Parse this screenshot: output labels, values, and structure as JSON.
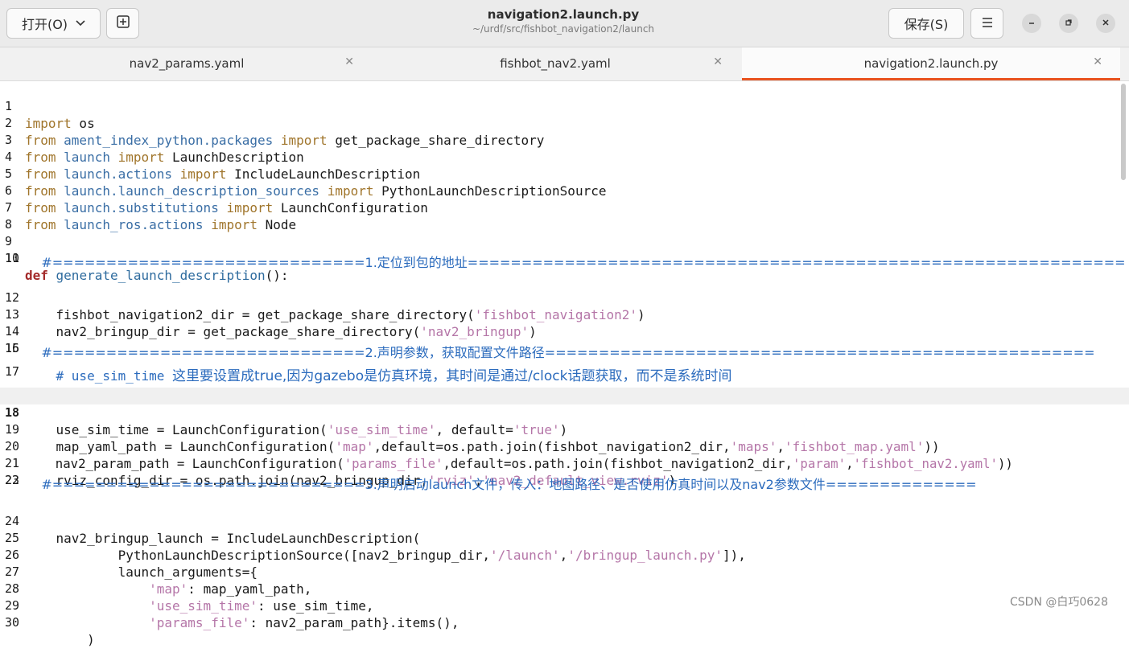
{
  "window": {
    "open_label": "打开(O)",
    "save_label": "保存(S)",
    "title": "navigation2.launch.py",
    "subtitle": "~/urdf/src/fishbot_navigation2/launch"
  },
  "icons": {
    "chevron": "chevron-down-icon",
    "pin": "pin-icon",
    "menu": "hamburger-icon",
    "minimize": "minimize-icon",
    "maximize": "restore-icon",
    "close": "close-icon"
  },
  "colors": {
    "accent": "#e95420",
    "keyword": "#a0752b",
    "string": "#b576a8",
    "comment": "#2b6bbd"
  },
  "tabs": [
    {
      "label": "nav2_params.yaml"
    },
    {
      "label": "fishbot_nav2.yaml"
    },
    {
      "label": "navigation2.launch.py"
    }
  ],
  "editor": {
    "current_line": 18,
    "lines": [
      {
        "n": "1"
      },
      {
        "n": "2"
      },
      {
        "n": "3"
      },
      {
        "n": "4"
      },
      {
        "n": "5"
      },
      {
        "n": "6"
      },
      {
        "n": "7"
      },
      {
        "n": "8"
      },
      {
        "n": "9"
      },
      {
        "n": "10"
      },
      {
        "n": "11"
      },
      {
        "n": "12"
      },
      {
        "n": "13"
      },
      {
        "n": "14"
      },
      {
        "n": "15"
      },
      {
        "n": "16"
      },
      {
        "n": "17"
      },
      {
        "n": "18"
      },
      {
        "n": "19"
      },
      {
        "n": "20"
      },
      {
        "n": "21"
      },
      {
        "n": "22"
      },
      {
        "n": "23"
      },
      {
        "n": "24"
      },
      {
        "n": "25"
      },
      {
        "n": "26"
      },
      {
        "n": "27"
      },
      {
        "n": "28"
      },
      {
        "n": "29"
      },
      {
        "n": "30"
      }
    ],
    "code": {
      "l1": {
        "kw": "import",
        "rest": " os"
      },
      "l2": {
        "kw1": "from",
        "mod": " ament_index_python.packages ",
        "kw2": "import",
        "rest": " get_package_share_directory"
      },
      "l3": {
        "kw1": "from",
        "mod": " launch ",
        "kw2": "import",
        "rest": " LaunchDescription"
      },
      "l4": {
        "kw1": "from",
        "mod": " launch.actions ",
        "kw2": "import",
        "rest": " IncludeLaunchDescription"
      },
      "l5": {
        "kw1": "from",
        "mod": " launch.launch_description_sources ",
        "kw2": "import",
        "rest": " PythonLaunchDescriptionSource"
      },
      "l6": {
        "kw1": "from",
        "mod": " launch.substitutions ",
        "kw2": "import",
        "rest": " LaunchConfiguration"
      },
      "l7": {
        "kw1": "from",
        "mod": " launch_ros.actions ",
        "kw2": "import",
        "rest": " Node"
      },
      "l10": {
        "def": "def",
        "fn": " generate_launch_description",
        "rest": "():"
      },
      "l11": {
        "comment": "    #=============================1.定位到包的地址============================================================="
      },
      "l12": {
        "a": "    fishbot_navigation2_dir = get_package_share_directory(",
        "s1": "'fishbot_navigation2'",
        "b": ")"
      },
      "l13": {
        "a": "    nav2_bringup_dir = get_package_share_directory(",
        "s1": "'nav2_bringup'",
        "b": ")"
      },
      "l16": {
        "comment": "    #=============================2.声明参数，获取配置文件路径==================================================="
      },
      "l17": {
        "c1": "    # use_sim_time ",
        "c2": "这里要设置成true,因为gazebo是仿真环境，其时间是通过/clock话题获取，而不是系统时间"
      },
      "l18": {
        "a": "    use_sim_time = LaunchConfiguration(",
        "s1": "'use_sim_time'",
        "b": ", default=",
        "s2": "'true'",
        "c": ")"
      },
      "l19": {
        "a": "    map_yaml_path = LaunchConfiguration(",
        "s1": "'map'",
        "b": ",default=os.path.join(fishbot_navigation2_dir,",
        "s2": "'maps'",
        "c": ",",
        "s3": "'fishbot_map.yaml'",
        "d": "))"
      },
      "l20": {
        "a": "    nav2_param_path = LaunchConfiguration(",
        "s1": "'params_file'",
        "b": ",default=os.path.join(fishbot_navigation2_dir,",
        "s2": "'param'",
        "c": ",",
        "s3": "'fishbot_nav2.yaml'",
        "d": "))"
      },
      "l21": {
        "a": "    rviz_config_dir = os.path.join(nav2_bringup_dir,",
        "s1": "'rviz'",
        "b": ",",
        "s2": "'nav2_default_view.rviz'",
        "c": ")"
      },
      "l23": {
        "comment": "    #=============================3.声明启动launch文件，传入：地图路径、是否使用仿真时间以及nav2参数文件=============="
      },
      "l24": {
        "a": "    nav2_bringup_launch = IncludeLaunchDescription("
      },
      "l25": {
        "a": "            PythonLaunchDescriptionSource([nav2_bringup_dir,",
        "s1": "'/launch'",
        "b": ",",
        "s2": "'/bringup_launch.py'",
        "c": "]),"
      },
      "l26": {
        "a": "            launch_arguments={"
      },
      "l27": {
        "i": "                ",
        "s1": "'map'",
        "b": ": map_yaml_path,"
      },
      "l28": {
        "i": "                ",
        "s1": "'use_sim_time'",
        "b": ": use_sim_time,"
      },
      "l29": {
        "i": "                ",
        "s1": "'params_file'",
        "b": ": nav2_param_path}.items(),"
      },
      "l30": {
        "a": "        )"
      }
    }
  },
  "watermark": "CSDN @白巧0628"
}
